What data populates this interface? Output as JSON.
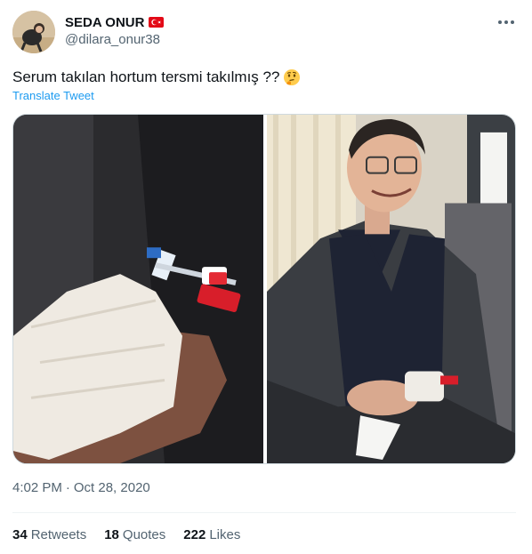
{
  "author": {
    "display_name": "SEDA ONUR",
    "handle": "@dilara_onur38",
    "flag_icon": "turkey-flag-icon",
    "avatar_icon": "user-avatar"
  },
  "tweet": {
    "text": "Serum takılan hortum tersmi takılmış ??",
    "emoji_icon": "thinking-face-emoji",
    "translate_label": "Translate Tweet"
  },
  "media": {
    "left_image": "photo-iv-line-hand",
    "right_image": "photo-man-in-chair"
  },
  "meta": {
    "time": "4:02 PM",
    "separator": "·",
    "date": "Oct 28, 2020"
  },
  "stats": {
    "retweets_count": "34",
    "retweets_label": "Retweets",
    "quotes_count": "18",
    "quotes_label": "Quotes",
    "likes_count": "222",
    "likes_label": "Likes"
  },
  "colors": {
    "text_primary": "#0f1419",
    "text_secondary": "#536471",
    "link": "#1d9bf0",
    "border": "#cfd9de"
  }
}
